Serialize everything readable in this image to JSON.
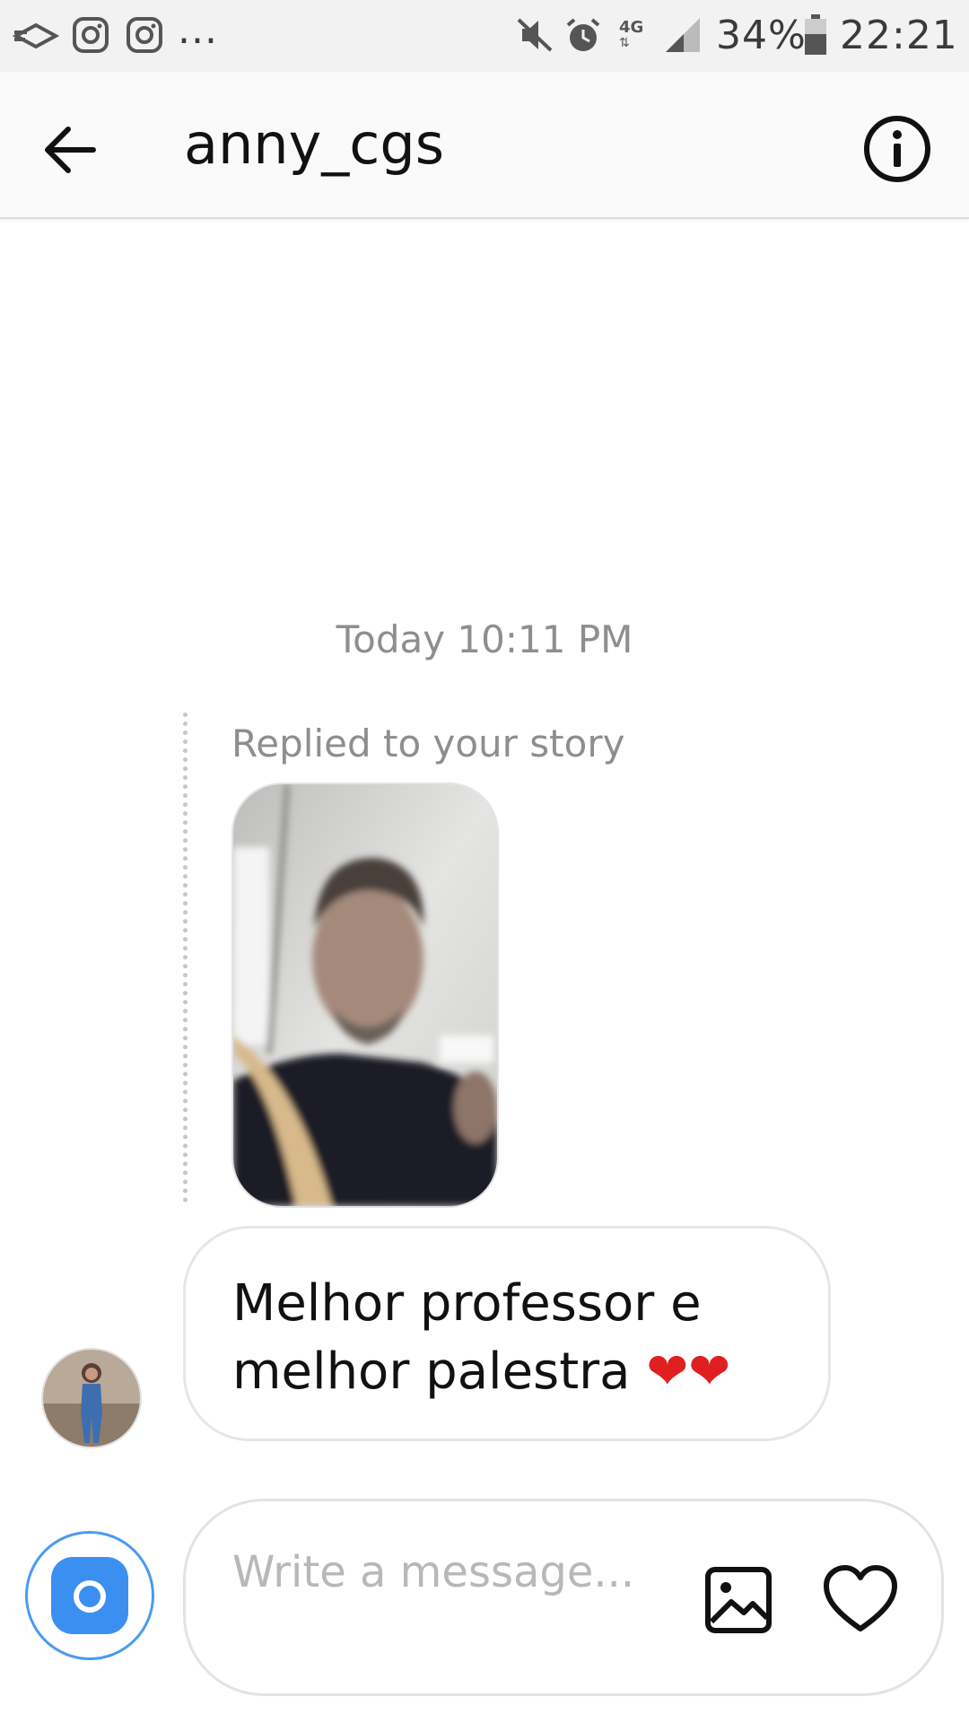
{
  "status_bar": {
    "icons": [
      "mail-send-icon",
      "instagram-icon",
      "instagram-icon",
      "more-notifications-icon",
      "mute-icon",
      "alarm-icon",
      "network-4g-icon",
      "signal-icon",
      "battery-icon"
    ],
    "more_text": "...",
    "network_label": "4G",
    "battery": "34%",
    "time": "22:21"
  },
  "header": {
    "username": "anny_cgs",
    "back_icon": "arrow-left-icon",
    "info_icon": "info-circle-icon"
  },
  "thread": {
    "timestamp": "Today 10:11 PM",
    "reply_label": "Replied to your story",
    "story_thumbnail_icon": "story-photo",
    "message": {
      "text": "Melhor professor e melhor palestra",
      "emoji": "❤❤"
    }
  },
  "composer": {
    "placeholder": "Write a message...",
    "camera_icon": "camera-icon",
    "gallery_icon": "gallery-icon",
    "like_icon": "heart-outline-icon"
  },
  "colors": {
    "accent_blue": "#3b8ff0",
    "heart_red": "#e02020",
    "muted_text": "#8e8e8e"
  }
}
